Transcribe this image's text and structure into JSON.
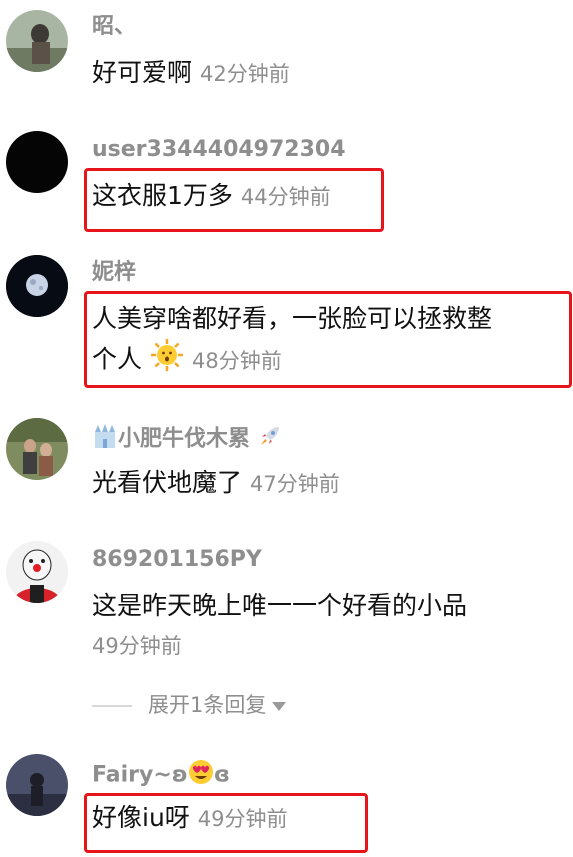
{
  "comments": [
    {
      "username": "昭、",
      "text": "好可爱啊",
      "time": "42分钟前"
    },
    {
      "username": "user3344404972304",
      "text": "这衣服1万多",
      "time": "44分钟前"
    },
    {
      "username": "妮梓",
      "text_line1": "人美穿啥都好看，一张脸可以拯救整",
      "text_line2": "个人",
      "time": "48分钟前"
    },
    {
      "username": "小肥牛伐木累",
      "text": "光看伏地魔了",
      "time": "47分钟前"
    },
    {
      "username": "869201156PY",
      "text": "这是昨天晚上唯一一个好看的小品",
      "time": "49分钟前"
    },
    {
      "username_prefix": "Fairy~ʚ",
      "username_suffix": "ɞ",
      "text": "好像iu呀",
      "time": "49分钟前"
    }
  ],
  "expand_replies": {
    "label": "展开1条回复"
  },
  "colors": {
    "highlight": "#e8141b",
    "meta": "#8e8e8e",
    "text": "#111111"
  }
}
